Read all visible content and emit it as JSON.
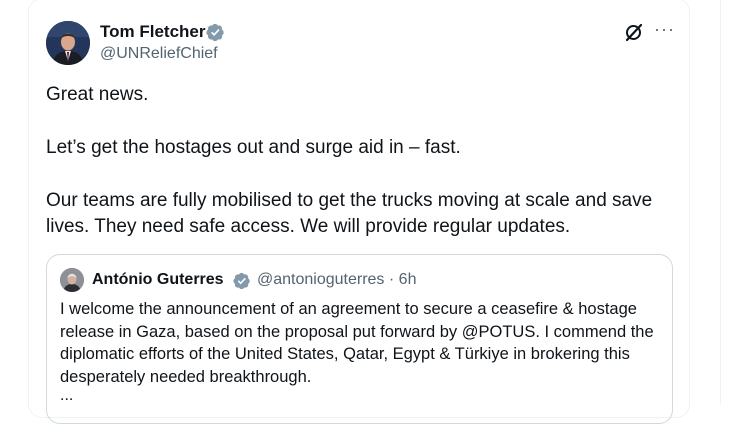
{
  "tweet": {
    "author_name": "Tom Fletcher",
    "author_handle": "@UNReliefChief",
    "paragraphs": [
      "Great news.",
      "Let’s get the hostages out and surge aid in – fast.",
      "Our teams are fully mobilised to get the trucks moving at scale and save lives. They need safe access. We will provide regular updates."
    ],
    "more_label": "···"
  },
  "quoted_tweet": {
    "author_name": "António Guterres",
    "author_handle": "@antonioguterres",
    "separator": "·",
    "time": "6h",
    "text": "I welcome the announcement of an agreement to secure a ceasefire & hostage release in Gaza, based on the proposal put forward by @POTUS. I commend the diplomatic efforts of the United States, Qatar, Egypt & Türkiye in brokering this desperately needed breakthrough.",
    "truncation": "..."
  },
  "colors": {
    "verified_badge": "#829aab",
    "text_primary": "#0f1419",
    "text_secondary": "#536471",
    "border": "#cfd9de"
  },
  "icons": {
    "verified": "verified-badge-icon",
    "grok": "grok-icon",
    "more": "more-options-icon"
  }
}
